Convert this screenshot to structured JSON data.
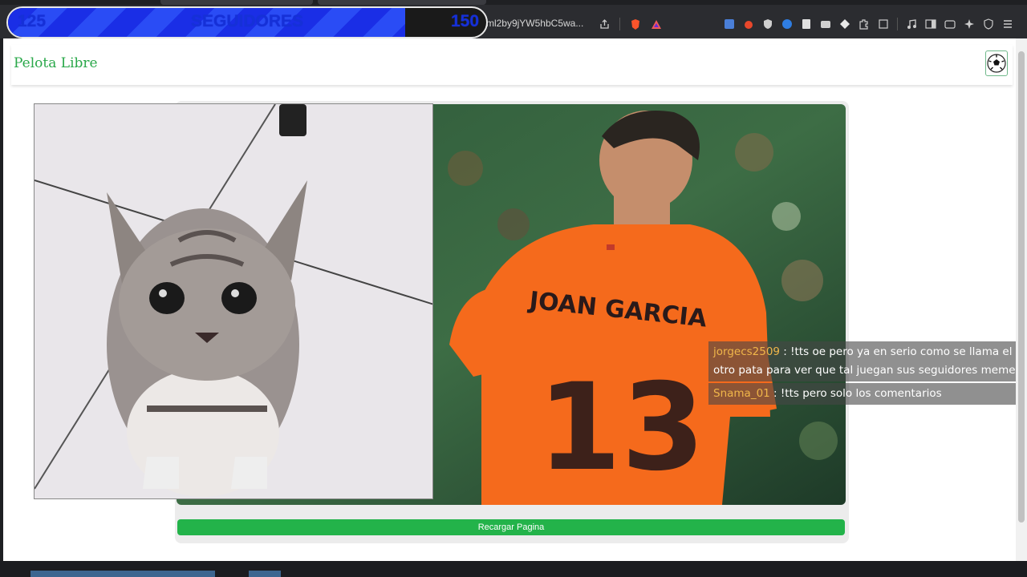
{
  "overlay": {
    "current": "125",
    "label": "SEGUIDORES",
    "target": "150",
    "progress_fraction": 0.83
  },
  "browser": {
    "url_fragment": "90aW9nb2xlZ2Vydml2by9jYW5hbC5wa..."
  },
  "page": {
    "brand": "Pelota Libre",
    "reload_button": "Recargar Pagina"
  },
  "chat": [
    {
      "user": "jorgecs2509",
      "text": " : !tts oe pero ya en serio como se llama el otro pata para ver que tal juegan sus seguidores meme"
    },
    {
      "user": "Snama_01",
      "text": " : !tts pero solo los comentarios"
    }
  ],
  "video": {
    "jersey_name": "JOAN GARCIA",
    "jersey_number": "13"
  },
  "colors": {
    "brand": "#2aa84a",
    "reload_button": "#23b34a",
    "overlay_fill": "#1a2ee6",
    "chat_user": "#f0b64a",
    "jersey": "#f56a1c"
  }
}
